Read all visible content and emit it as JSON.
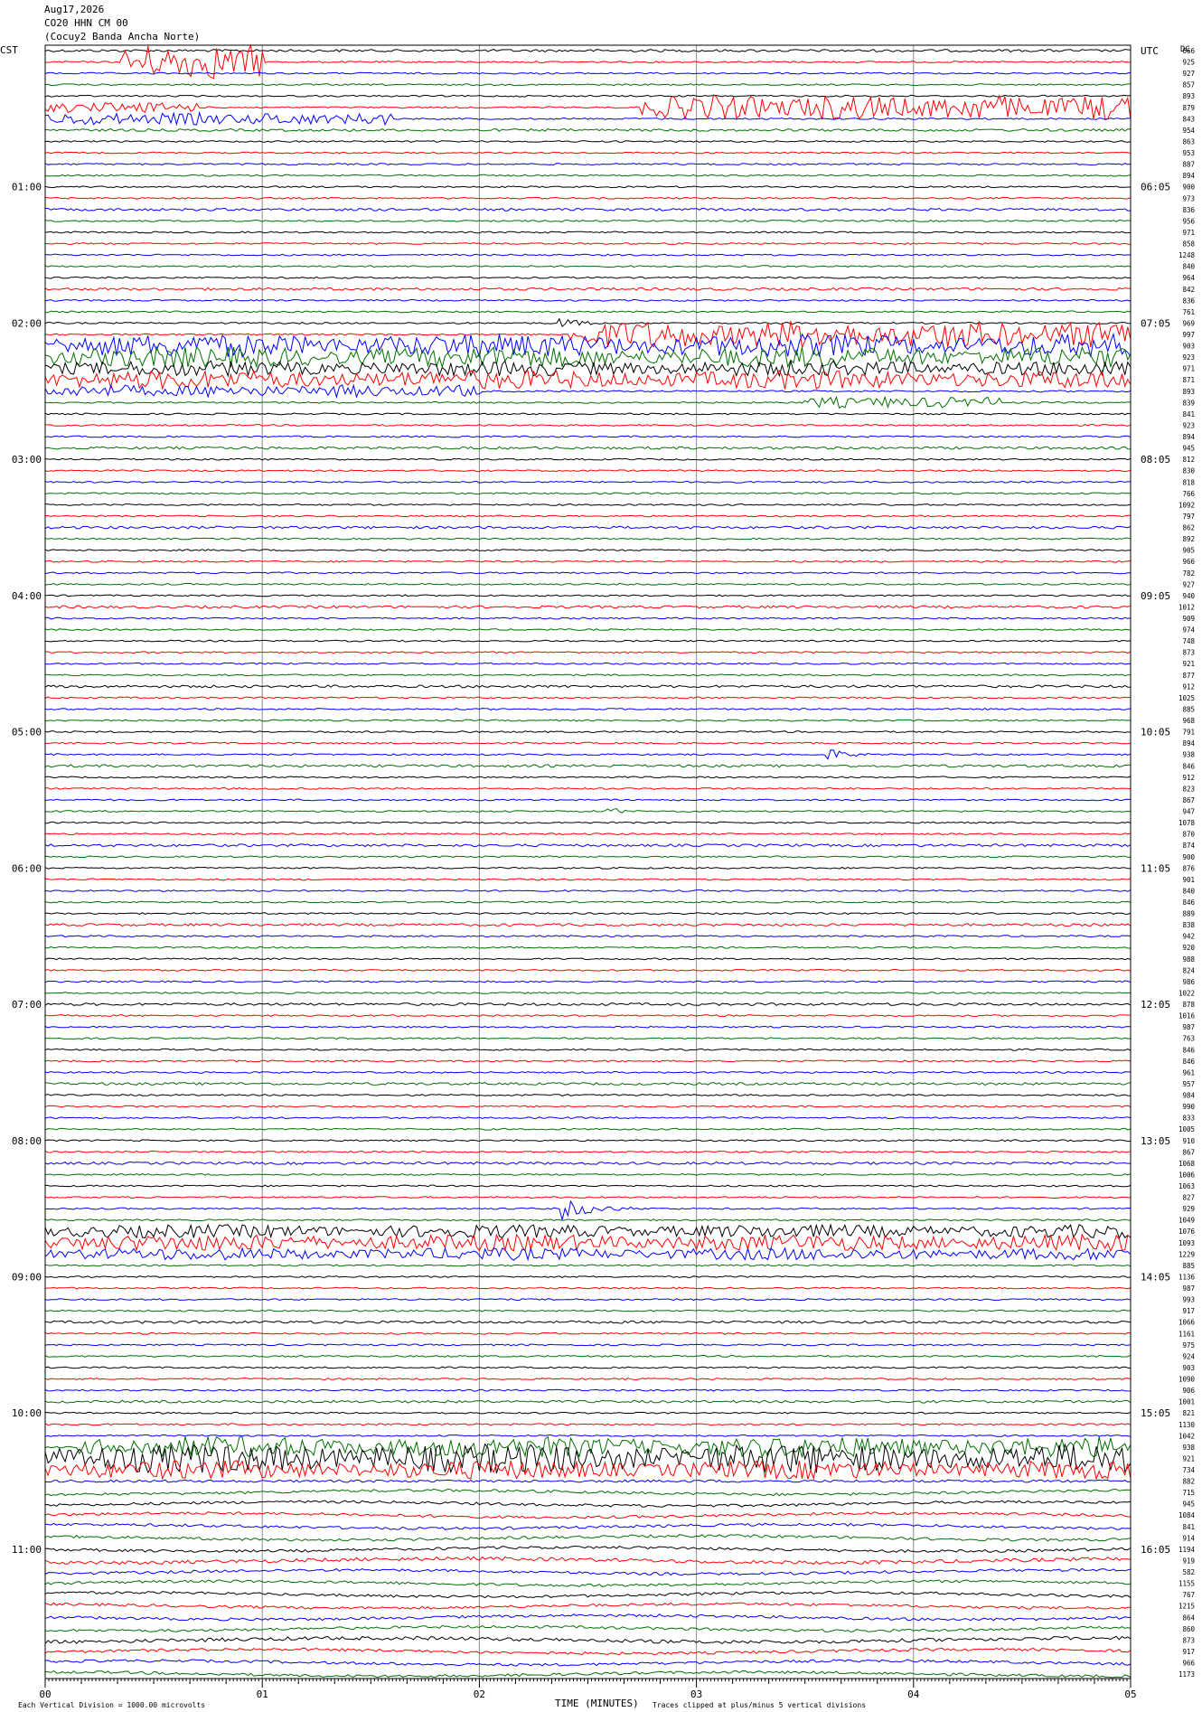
{
  "header": {
    "date": "Aug17,2026",
    "station": "CO20 HHN CM 00",
    "site": "(Cocuy2 Banda Ancha Norte)"
  },
  "left_zone_label": "CST",
  "right_zone_label": "UTC",
  "right_column_label": "DC",
  "footer": {
    "scale_note": "Each Vertical Division = 1000.00 microvolts",
    "x_title": "TIME (MINUTES)",
    "clip_note": "Traces clipped at plus/minus 5 vertical divisions"
  },
  "colors": {
    "trace_cycle": [
      "#000000",
      "#ff0000",
      "#0000ff",
      "#007000"
    ],
    "grid": "#8c8c8c",
    "frame": "#000000"
  },
  "chart_data": {
    "type": "line",
    "description_of_type": "helicorder",
    "x_axis": {
      "label": "TIME (MINUTES)",
      "range": [
        0,
        5
      ],
      "ticks": [
        "00",
        "01",
        "02",
        "03",
        "04",
        "05"
      ]
    },
    "trace_count": 144,
    "left_hour_labels": [
      {
        "row": 12,
        "label": "01:00"
      },
      {
        "row": 24,
        "label": "02:00"
      },
      {
        "row": 36,
        "label": "03:00"
      },
      {
        "row": 48,
        "label": "04:00"
      },
      {
        "row": 60,
        "label": "05:00"
      },
      {
        "row": 72,
        "label": "06:00"
      },
      {
        "row": 84,
        "label": "07:00"
      },
      {
        "row": 96,
        "label": "08:00"
      },
      {
        "row": 108,
        "label": "09:00"
      },
      {
        "row": 120,
        "label": "10:00"
      },
      {
        "row": 132,
        "label": "11:00"
      }
    ],
    "right_hour_labels": [
      {
        "row": 0,
        "label": "UTC"
      },
      {
        "row": 12,
        "label": "06:05"
      },
      {
        "row": 24,
        "label": "07:05"
      },
      {
        "row": 36,
        "label": "08:05"
      },
      {
        "row": 48,
        "label": "09:05"
      },
      {
        "row": 60,
        "label": "10:05"
      },
      {
        "row": 72,
        "label": "11:05"
      },
      {
        "row": 84,
        "label": "12:05"
      },
      {
        "row": 96,
        "label": "13:05"
      },
      {
        "row": 108,
        "label": "14:05"
      },
      {
        "row": 120,
        "label": "15:05"
      },
      {
        "row": 132,
        "label": "16:05"
      }
    ],
    "dc_offsets": [
      "666",
      "925",
      "927",
      "857",
      "893",
      "879",
      "843",
      "954",
      "863",
      "953",
      "887",
      "894",
      "900",
      "973",
      "836",
      "956",
      "971",
      "858",
      "1248",
      "840",
      "964",
      "842",
      "836",
      "761",
      "969",
      "997",
      "903",
      "923",
      "971",
      "871",
      "893",
      "839",
      "841",
      "923",
      "894",
      "945",
      "812",
      "830",
      "818",
      "766",
      "1092",
      "797",
      "862",
      "892",
      "905",
      "966",
      "782",
      "927",
      "940",
      "1012",
      "909",
      "974",
      "748",
      "873",
      "921",
      "877",
      "912",
      "1025",
      "885",
      "968",
      "791",
      "894",
      "938",
      "846",
      "912",
      "823",
      "867",
      "947",
      "1078",
      "870",
      "874",
      "900",
      "876",
      "901",
      "840",
      "846",
      "889",
      "838",
      "942",
      "920",
      "988",
      "824",
      "986",
      "1022",
      "878",
      "1016",
      "987",
      "763",
      "846",
      "846",
      "961",
      "957",
      "984",
      "990",
      "833",
      "1005",
      "910",
      "867",
      "1068",
      "1006",
      "1063",
      "827",
      "929",
      "1049",
      "1076",
      "1093",
      "1229",
      "885",
      "1136",
      "987",
      "993",
      "917",
      "1066",
      "1161",
      "975",
      "924",
      "903",
      "1090",
      "906",
      "1001",
      "821",
      "1130",
      "1042",
      "938",
      "921",
      "734",
      "882",
      "715",
      "945",
      "1084",
      "841",
      "914",
      "1194",
      "919",
      "582",
      "1155",
      "767",
      "1215",
      "864",
      "860",
      "873",
      "917",
      "966",
      "1173"
    ],
    "events": [
      {
        "row": 1,
        "start_min": 0.35,
        "end_min": 1.0,
        "amp": 3.2
      },
      {
        "row": 5,
        "start_min": 2.75,
        "end_min": 5.0,
        "amp": 2.2
      },
      {
        "row": 5,
        "start_min": 0.0,
        "end_min": 0.7,
        "amp": 0.8
      },
      {
        "row": 6,
        "start_min": 0.0,
        "end_min": 1.6,
        "amp": 1.0
      },
      {
        "row": 24,
        "start_min": 2.35,
        "end_min": 2.6,
        "amp": 1.2
      },
      {
        "row": 25,
        "start_min": 2.4,
        "end_min": 5.0,
        "amp": 2.4
      },
      {
        "row": 26,
        "start_min": 0.0,
        "end_min": 5.0,
        "amp": 2.0
      },
      {
        "row": 27,
        "start_min": 0.0,
        "end_min": 5.0,
        "amp": 1.8
      },
      {
        "row": 28,
        "start_min": 0.0,
        "end_min": 5.0,
        "amp": 1.2
      },
      {
        "row": 29,
        "start_min": 0.0,
        "end_min": 5.0,
        "amp": 1.6
      },
      {
        "row": 30,
        "start_min": 0.0,
        "end_min": 2.0,
        "amp": 1.0
      },
      {
        "row": 31,
        "start_min": 3.5,
        "end_min": 4.4,
        "amp": 0.9
      },
      {
        "row": 62,
        "start_min": 3.6,
        "end_min": 3.8,
        "amp": 1.3
      },
      {
        "row": 67,
        "start_min": 2.58,
        "end_min": 2.7,
        "amp": 1.4
      },
      {
        "row": 102,
        "start_min": 2.38,
        "end_min": 2.75,
        "amp": 2.0
      },
      {
        "row": 104,
        "start_min": 0.0,
        "end_min": 5.0,
        "amp": 1.1
      },
      {
        "row": 105,
        "start_min": 0.0,
        "end_min": 5.0,
        "amp": 1.3
      },
      {
        "row": 106,
        "start_min": 0.0,
        "end_min": 5.0,
        "amp": 1.0
      },
      {
        "row": 123,
        "start_min": 0.15,
        "end_min": 5.0,
        "amp": 1.8
      },
      {
        "row": 124,
        "start_min": 0.0,
        "end_min": 5.0,
        "amp": 2.6
      },
      {
        "row": 125,
        "start_min": 0.0,
        "end_min": 5.0,
        "amp": 1.6
      }
    ]
  }
}
